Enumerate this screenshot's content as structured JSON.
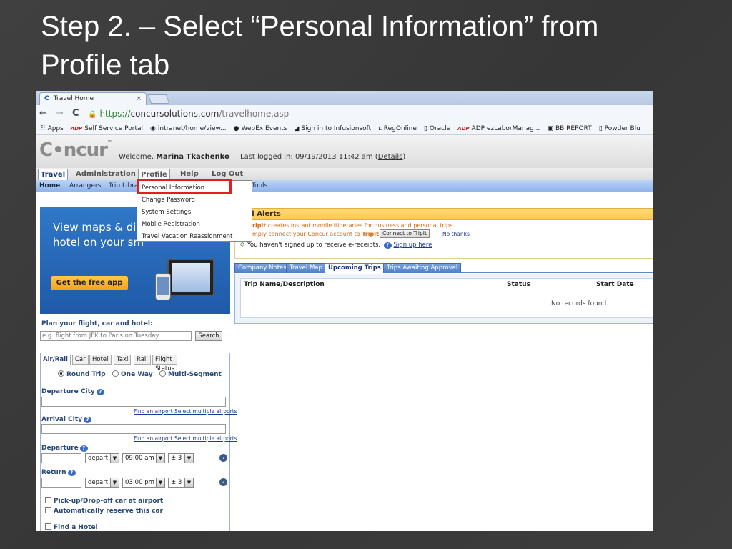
{
  "slide": {
    "title_line1": "Step 2. – Select “Personal Information” from",
    "title_bold": "Profile",
    "title_rest": " tab"
  },
  "browser": {
    "tab_title": "Travel Home",
    "tab_close": "×",
    "back": "←",
    "forward": "→",
    "reload": "C",
    "url_scheme": "https://",
    "url_host": "concursolutions.com",
    "url_path": "/travelhome.asp",
    "bookmarks": [
      {
        "icon": "apps-icon",
        "glyph": "⠿",
        "label": "Apps"
      },
      {
        "icon": "adp-icon",
        "glyph": "ADP",
        "label": "Self Service Portal"
      },
      {
        "icon": "globe-icon",
        "glyph": "◉",
        "label": "intranet/home/view..."
      },
      {
        "icon": "webex-icon",
        "glyph": "●",
        "label": "WebEx Events"
      },
      {
        "icon": "infusionsoft-icon",
        "glyph": "◢",
        "label": "Sign in to Infusionsoft"
      },
      {
        "icon": "regonline-icon",
        "glyph": "ʟ",
        "label": "RegOnline"
      },
      {
        "icon": "page-icon",
        "glyph": "▯",
        "label": "Oracle"
      },
      {
        "icon": "adp-icon",
        "glyph": "ADP",
        "label": "ADP ezLaborManag..."
      },
      {
        "icon": "report-icon",
        "glyph": "▣",
        "label": "BB REPORT"
      },
      {
        "icon": "page-icon",
        "glyph": "▯",
        "label": "Powder Blu"
      }
    ]
  },
  "concur": {
    "logo": "C•ncur",
    "logo_tm": "™",
    "welcome_prefix": "Welcome, ",
    "user_name": "Marina Tkachenko",
    "last_logged_prefix": "Last logged in: 09/19/2013 11:42 am (",
    "details_link": "Details",
    "last_logged_suffix": ")",
    "main_tabs": {
      "travel": "Travel",
      "administration": "Administration",
      "profile": "Profile",
      "help": "Help",
      "logout": "Log Out"
    },
    "sub_nav": {
      "home": "Home",
      "arrangers": "Arrangers",
      "trip_library": "Trip Libra",
      "tools": "Tools"
    },
    "profile_menu": [
      "Personal Information",
      "Change Password",
      "System Settings",
      "Mobile Registration",
      "Travel Vacation Reassignment"
    ]
  },
  "promo": {
    "line1": "View maps & dir",
    "line2": "hotel on your sm",
    "button": "Get the free app"
  },
  "search": {
    "label": "Plan your flight, car and hotel:",
    "placeholder": "e.g. flight from JFK to Paris on Tuesday",
    "button": "Search"
  },
  "booking": {
    "tabs": [
      "Air/Rail",
      "Car",
      "Hotel",
      "Taxi",
      "Rail",
      "Flight Status"
    ],
    "trip_types": [
      "Round Trip",
      "One Way",
      "Multi-Segment"
    ],
    "departure_city": "Departure City",
    "arrival_city": "Arrival City",
    "airport_links": "Find an airport Select multiple airports",
    "departure": "Departure",
    "return": "Return",
    "depart_select": "depart",
    "dep_time": "09:00 am",
    "ret_time": "03:00 pm",
    "window": "± 3",
    "pickup": "Pick-up/Drop-off car at airport",
    "auto_reserve": "Automatically reserve this car",
    "find_hotel": "Find a Hotel"
  },
  "alerts": {
    "title": "vel Alerts",
    "line1_bold": "ripIt",
    "line1": " creates instant mobile itineraries for business and personal trips.",
    "line2_prefix": "mply connect your Concur account to ",
    "line2_bold": "TripIt",
    "connect_button": "Connect to TripIt",
    "no_thanks": "No thanks",
    "ereceipt": "You haven't signed up to receive e-receipts.",
    "signup": "Sign up here"
  },
  "trips": {
    "tabs": [
      "Company Notes",
      "Travel Map",
      "Upcoming Trips",
      "Trips Awaiting Approval"
    ],
    "col_trip": "Trip Name/Description",
    "col_status": "Status",
    "col_start": "Start Date",
    "empty": "No records found."
  },
  "colors": {
    "highlight": "#e02020",
    "concur_blue": "#1a3a7a",
    "alert_orange": "#d46a12"
  }
}
